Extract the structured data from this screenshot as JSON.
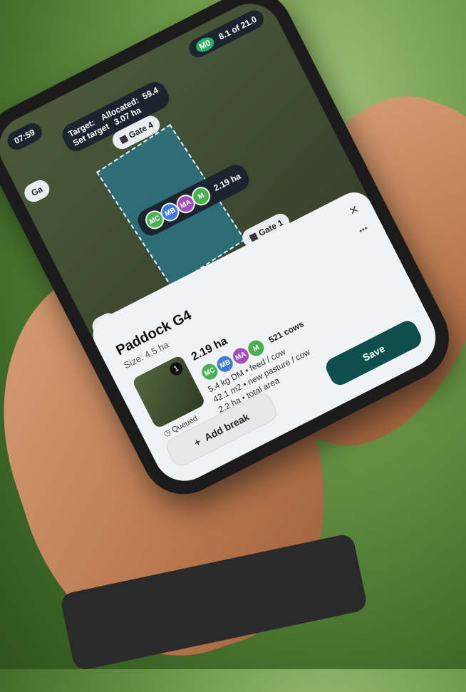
{
  "status_bar": {
    "time": "07:59"
  },
  "header": {
    "target_label": "Target:",
    "allocated_label": "Allocated:",
    "allocated_value": "59.4",
    "set_target": "Set target",
    "set_target_value": "3.07 ha",
    "counter": "8.1 of 21.0",
    "counter_badge": "M0"
  },
  "map": {
    "gate4": "Gate 4",
    "gate1": "Gate 1",
    "gate2": "e 2",
    "gate_left": "Ga",
    "area_pill": "2.19 ha",
    "avatars": [
      "MC",
      "MB",
      "MA",
      "M"
    ]
  },
  "sheet": {
    "title": "Paddock G4",
    "size": "Size: 4.5 ha",
    "area": "2.19 ha",
    "cows": "521 cows",
    "line1": "5.4 kg DM • feed / cow",
    "line2": "42.1 m2 • new pasture / cow",
    "line3": "2.2 ha • total area",
    "queued": "Queued",
    "thumb_number": "1",
    "more": "•••",
    "close": "×",
    "add_break": "Add break",
    "save": "Save"
  }
}
